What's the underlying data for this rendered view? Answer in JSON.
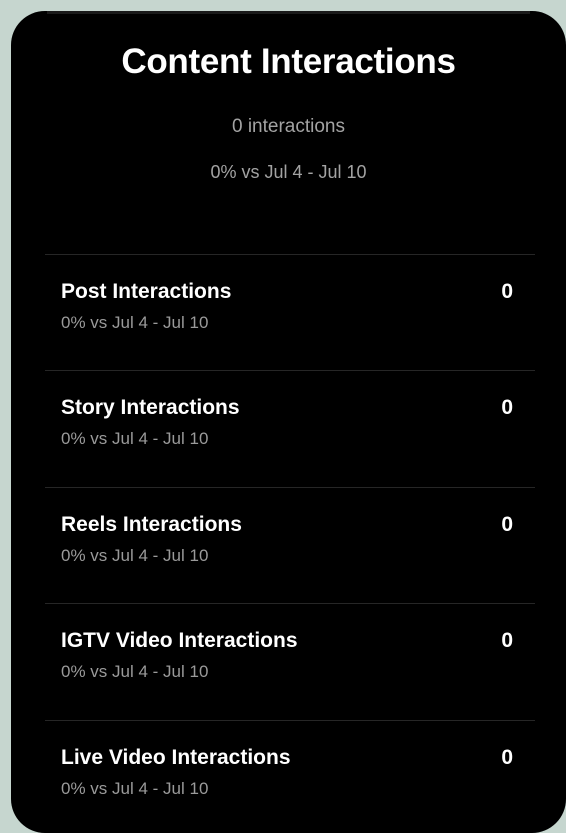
{
  "card": {
    "title": "Content Interactions",
    "total_interactions": "0 interactions",
    "comparison": "0% vs Jul 4 - Jul 10"
  },
  "metrics": [
    {
      "label": "Post Interactions",
      "comparison": "0% vs Jul 4 - Jul 10",
      "value": "0"
    },
    {
      "label": "Story Interactions",
      "comparison": "0% vs Jul 4 - Jul 10",
      "value": "0"
    },
    {
      "label": "Reels Interactions",
      "comparison": "0% vs Jul 4 - Jul 10",
      "value": "0"
    },
    {
      "label": "IGTV Video Interactions",
      "comparison": "0% vs Jul 4 - Jul 10",
      "value": "0"
    },
    {
      "label": "Live Video Interactions",
      "comparison": "0% vs Jul 4 - Jul 10",
      "value": "0"
    }
  ],
  "colors": {
    "background": "#c6d6cf",
    "card": "#000000",
    "primary_text": "#ffffff",
    "secondary_text": "#a3a3a3",
    "divider": "#262626"
  }
}
